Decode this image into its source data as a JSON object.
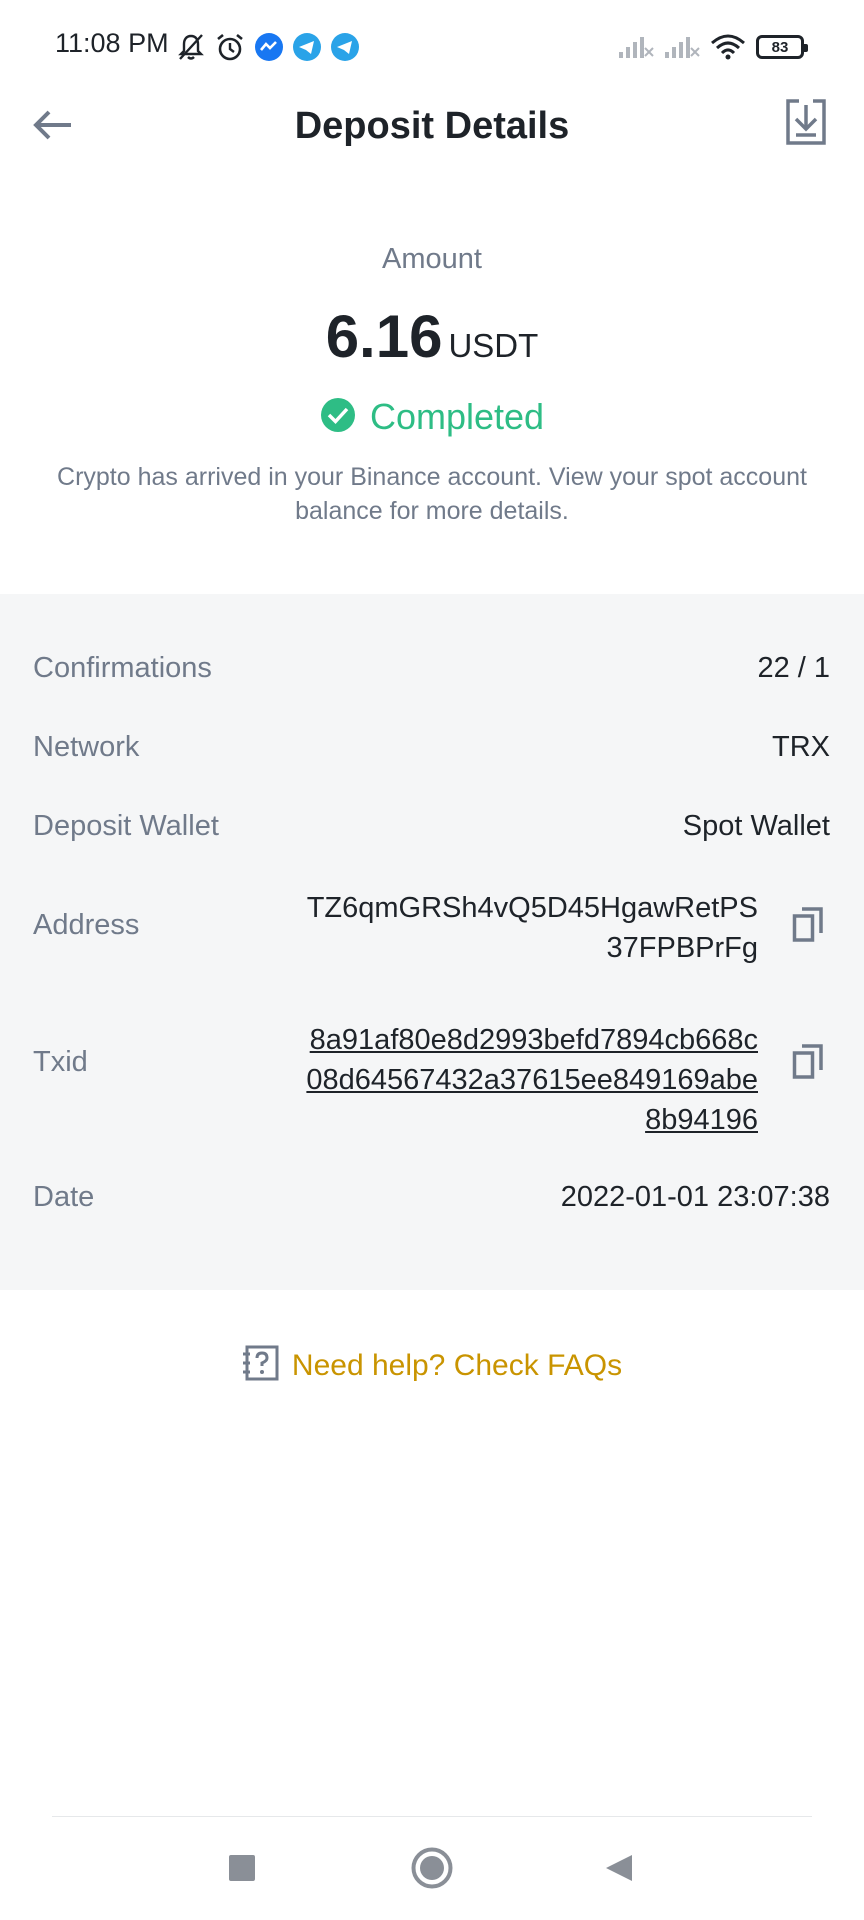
{
  "status_bar": {
    "time": "11:08 PM",
    "battery": "83",
    "left_icons": [
      "bell-off-icon",
      "alarm-icon",
      "messenger-icon",
      "telegram-icon",
      "telegram-icon"
    ],
    "right_icons": [
      "signal-icon",
      "signal-icon",
      "wifi-icon",
      "battery-icon"
    ]
  },
  "header": {
    "title": "Deposit Details",
    "back_icon": "back-arrow-icon",
    "action_icon": "download-icon"
  },
  "amount": {
    "label": "Amount",
    "value": "6.16",
    "unit": "USDT"
  },
  "status": {
    "text": "Completed",
    "color": "#2ebd85",
    "icon": "check-circle-icon"
  },
  "info": "Crypto has arrived in your Binance account. View your spot account balance for more details.",
  "details": {
    "confirmations": {
      "label": "Confirmations",
      "value": "22 / 1"
    },
    "network": {
      "label": "Network",
      "value": "TRX"
    },
    "deposit_wallet": {
      "label": "Deposit Wallet",
      "value": "Spot Wallet"
    },
    "address": {
      "label": "Address",
      "value": "TZ6qmGRSh4vQ5D45HgawRetPS37FPBPrFg"
    },
    "txid": {
      "label": "Txid",
      "value": "8a91af80e8d2993befd7894cb668c08d64567432a37615ee849169abe8b94196"
    },
    "date": {
      "label": "Date",
      "value": "2022-01-01 23:07:38"
    }
  },
  "help": {
    "text": "Need help? Check FAQs",
    "color": "#c99400",
    "icon": "faq-icon"
  },
  "nav": [
    "recent-apps-icon",
    "home-icon",
    "back-icon"
  ],
  "colors": {
    "primary_text": "#1e2329",
    "secondary_text": "#707a8a",
    "panel_background": "#f5f6f7"
  }
}
